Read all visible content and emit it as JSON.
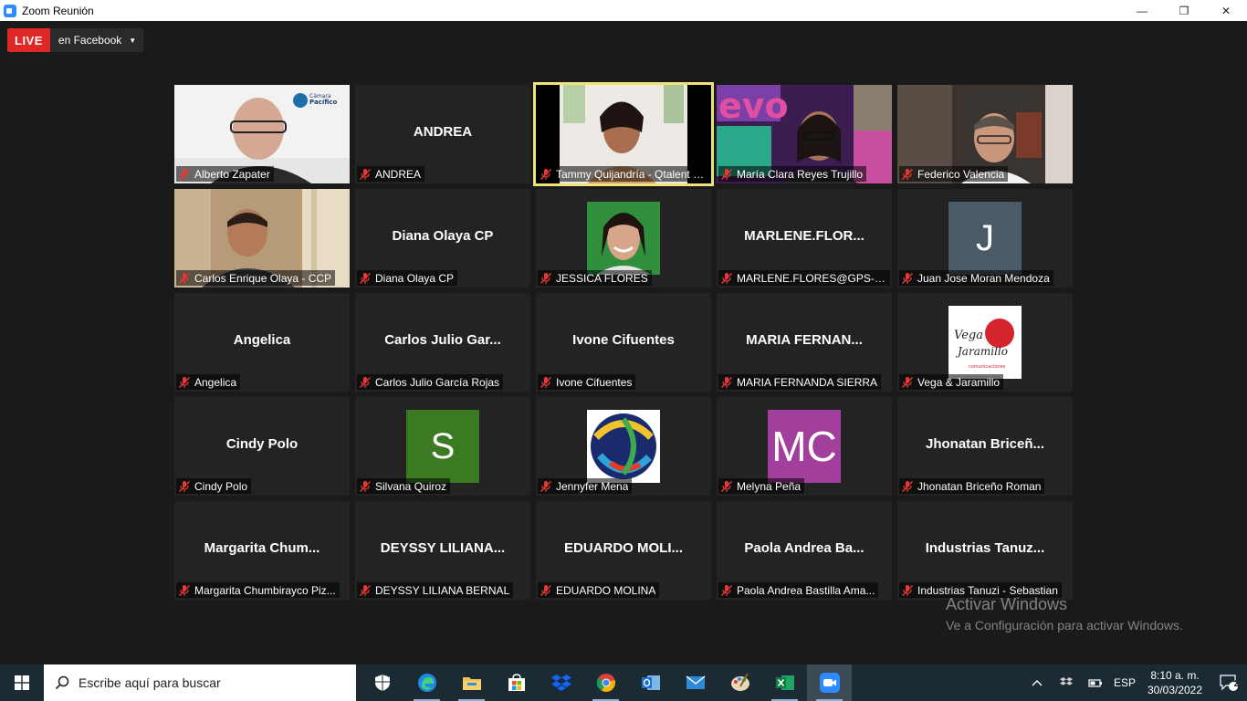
{
  "window": {
    "title": "Zoom Reunión",
    "min": "—",
    "restore": "❐",
    "close": "✕"
  },
  "live": {
    "badge": "LIVE",
    "destination": "en Facebook"
  },
  "participants": [
    {
      "name": "Alberto Zapater",
      "big": "",
      "kind": "video"
    },
    {
      "name": "ANDREA",
      "big": "ANDREA",
      "kind": "name"
    },
    {
      "name": "Tammy Quijandría - Qtalent G...",
      "big": "",
      "kind": "video",
      "active": true
    },
    {
      "name": "María Clara Reyes Trujillo",
      "big": "",
      "kind": "video"
    },
    {
      "name": "Federico Valencia",
      "big": "",
      "kind": "video"
    },
    {
      "name": "Carlos Enrique Olaya - CCP",
      "big": "",
      "kind": "video"
    },
    {
      "name": "Diana Olaya CP",
      "big": "Diana Olaya CP",
      "kind": "name"
    },
    {
      "name": "JESSICA FLORES",
      "big": "",
      "kind": "photo"
    },
    {
      "name": "MARLENE.FLORES@GPS-IN...",
      "big": "MARLENE.FLOR...",
      "kind": "name"
    },
    {
      "name": "Juan Jose Moran Mendoza",
      "big": "J",
      "kind": "letter"
    },
    {
      "name": "Angelica",
      "big": "Angelica",
      "kind": "name"
    },
    {
      "name": "Carlos Julio García Rojas",
      "big": "Carlos Julio Gar...",
      "kind": "name"
    },
    {
      "name": "Ivone Cifuentes",
      "big": "Ivone Cifuentes",
      "kind": "name"
    },
    {
      "name": "MARIA FERNANDA SIERRA",
      "big": "MARIA FERNAN...",
      "kind": "name"
    },
    {
      "name": "Vega & Jaramillo",
      "big": "",
      "kind": "logo"
    },
    {
      "name": "Cindy Polo",
      "big": "Cindy Polo",
      "kind": "name"
    },
    {
      "name": "Silvana Quiroz",
      "big": "S",
      "kind": "letter"
    },
    {
      "name": "Jennyfer Mena",
      "big": "",
      "kind": "logo2"
    },
    {
      "name": "Melyna Peña",
      "big": "MC",
      "kind": "letter"
    },
    {
      "name": "Jhonatan Briceño Roman",
      "big": "Jhonatan Briceñ...",
      "kind": "name"
    },
    {
      "name": "Margarita Chumbirayco Piz...",
      "big": "Margarita Chum...",
      "kind": "name"
    },
    {
      "name": "DEYSSY LILIANA BERNAL",
      "big": "DEYSSY LILIANA...",
      "kind": "name"
    },
    {
      "name": "EDUARDO MOLINA",
      "big": "EDUARDO MOLI...",
      "kind": "name"
    },
    {
      "name": "Paola Andrea Bastilla Ama...",
      "big": "Paola Andrea Ba...",
      "kind": "name"
    },
    {
      "name": "Industrias Tanuzi - Sebastian",
      "big": "Industrias Tanuz...",
      "kind": "name"
    }
  ],
  "logo_text": {
    "camara": "Cámara del Pacífico",
    "vega": "Vega & Jaramillo",
    "vega_sub": "comunicaciones",
    "evo": "evo"
  },
  "watermark": {
    "line1": "Activar Windows",
    "line2": "Ve a Configuración para activar Windows."
  },
  "taskbar": {
    "search_placeholder": "Escribe aquí para buscar",
    "icons": [
      "shield-icon",
      "edge-icon",
      "file-explorer-icon",
      "store-icon",
      "dropbox-icon",
      "chrome-icon",
      "outlook-icon",
      "mail-icon",
      "paint-icon",
      "excel-icon",
      "zoom-icon"
    ],
    "language": "ESP",
    "time": "8:10 a. m.",
    "date": "30/03/2022",
    "notifications": "2"
  },
  "colors": {
    "active_border": "#f0e27a",
    "live_red": "#e02828",
    "tile_bg": "#232323",
    "silvana_bg": "#3c7a22",
    "melyna_bg": "#a23e9b",
    "juan_bg": "#4a5a66"
  }
}
